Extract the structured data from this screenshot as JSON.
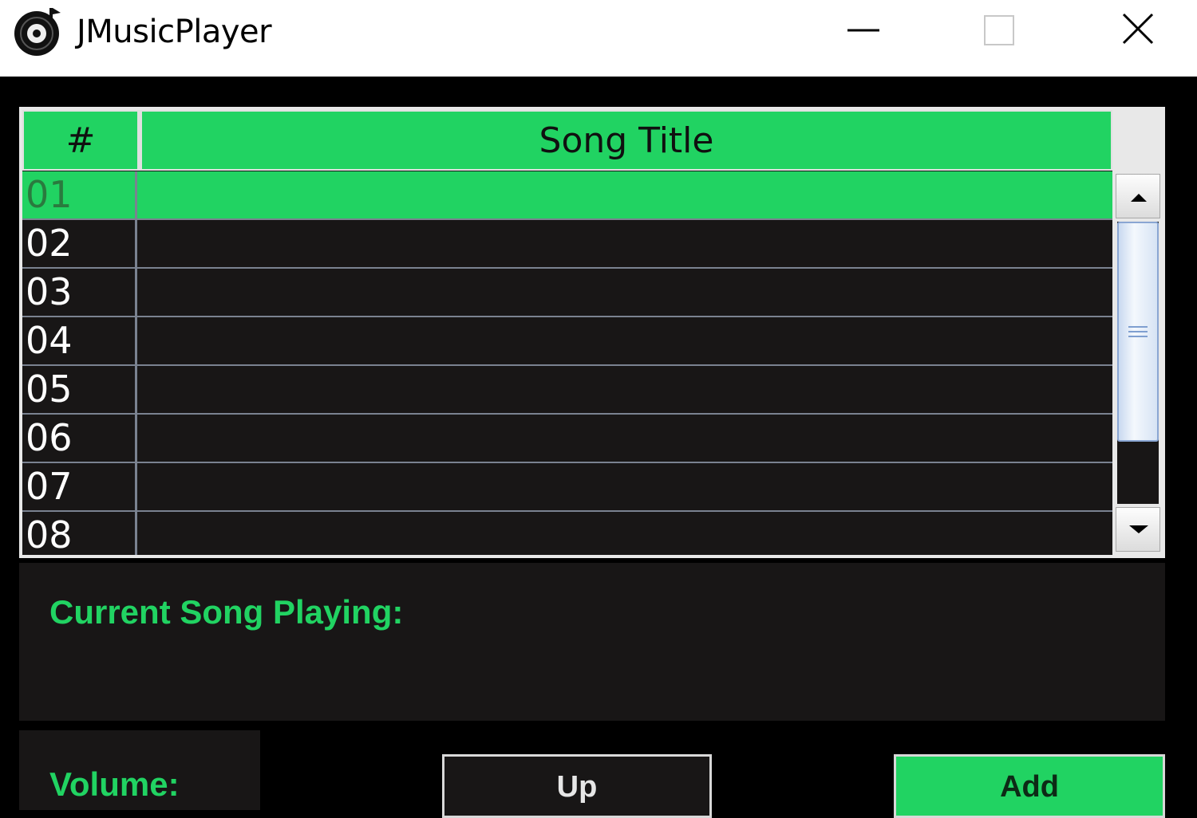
{
  "window": {
    "title": "JMusicPlayer",
    "icon": "vinyl-disc-icon"
  },
  "window_controls": {
    "minimize_icon": "minimize-icon",
    "maximize_icon": "maximize-icon",
    "close_icon": "close-icon"
  },
  "table": {
    "columns": [
      "#",
      "Song Title"
    ],
    "rows": [
      {
        "num": "01",
        "title": "",
        "selected": true
      },
      {
        "num": "02",
        "title": ""
      },
      {
        "num": "03",
        "title": ""
      },
      {
        "num": "04",
        "title": ""
      },
      {
        "num": "05",
        "title": ""
      },
      {
        "num": "06",
        "title": ""
      },
      {
        "num": "07",
        "title": ""
      },
      {
        "num": "08",
        "title": ""
      }
    ]
  },
  "now_playing": {
    "label": "Current Song Playing:",
    "value": ""
  },
  "controls": {
    "volume_label": "Volume:",
    "up_label": "Up",
    "add_label": "Add"
  },
  "colors": {
    "accent": "#21d362",
    "background": "#000000",
    "panel": "#181616"
  }
}
